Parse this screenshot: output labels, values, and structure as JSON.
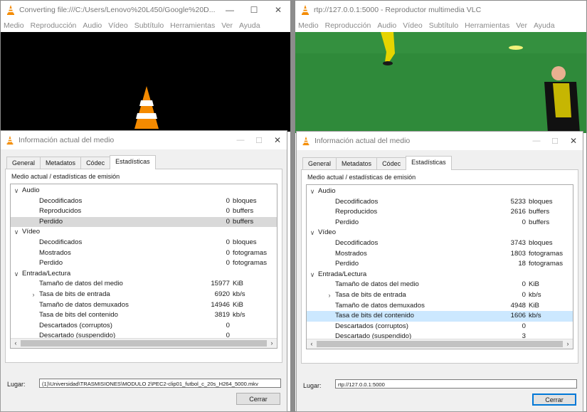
{
  "windows": [
    {
      "title": "Converting file:///C:/Users/Lenovo%20L450/Google%20D...",
      "menu": [
        "Medio",
        "Reproducción",
        "Audio",
        "Vídeo",
        "Subtítulo",
        "Herramientas",
        "Ver",
        "Ayuda"
      ],
      "controls": [
        "—",
        "☐",
        "✕"
      ]
    },
    {
      "title": "rtp://127.0.0.1:5000 - Reproductor multimedia VLC",
      "menu": [
        "Medio",
        "Reproducción",
        "Audio",
        "Vídeo",
        "Subtítulo",
        "Herramientas",
        "Ver",
        "Ayuda"
      ],
      "controls": [
        "—",
        "☐",
        "✕"
      ]
    }
  ],
  "dialogs": [
    {
      "title": "Información actual del medio",
      "tabs": [
        "General",
        "Metadatos",
        "Códec",
        "Estadísticas"
      ],
      "active_tab": "Estadísticas",
      "panel_title": "Medio actual / estadísticas de emisión",
      "rows": [
        {
          "type": "group",
          "label": "Audio",
          "exp": "∨"
        },
        {
          "type": "item",
          "label": "Decodificados",
          "value": "0",
          "unit": "bloques"
        },
        {
          "type": "item",
          "label": "Reproducidos",
          "value": "0",
          "unit": "buffers"
        },
        {
          "type": "item",
          "label": "Perdido",
          "value": "0",
          "unit": "buffers",
          "highlight": "gray"
        },
        {
          "type": "group",
          "label": "Vídeo",
          "exp": "∨"
        },
        {
          "type": "item",
          "label": "Decodificados",
          "value": "0",
          "unit": "bloques"
        },
        {
          "type": "item",
          "label": "Mostrados",
          "value": "0",
          "unit": "fotogramas"
        },
        {
          "type": "item",
          "label": "Perdido",
          "value": "0",
          "unit": "fotogramas"
        },
        {
          "type": "group",
          "label": "Entrada/Lectura",
          "exp": "∨"
        },
        {
          "type": "item",
          "label": "Tamaño de datos del medio",
          "value": "15977",
          "unit": "KiB"
        },
        {
          "type": "item",
          "label": "Tasa de bits de entrada",
          "value": "6920",
          "unit": "kb/s",
          "exp": "›"
        },
        {
          "type": "item",
          "label": "Tamaño de datos demuxados",
          "value": "14946",
          "unit": "KiB"
        },
        {
          "type": "item",
          "label": "Tasa de bits del contenido",
          "value": "3819",
          "unit": "kb/s"
        },
        {
          "type": "item",
          "label": "Descartados (corruptos)",
          "value": "0",
          "unit": ""
        },
        {
          "type": "item",
          "label": "Descartado (suspendido)",
          "value": "0",
          "unit": ""
        }
      ],
      "lugar_label": "Lugar:",
      "lugar_value": "(1)\\Universidad\\TRASMISIONES\\MODULO 2\\PEC2-clip01_futbol_c_20s_H264_5000.mkv",
      "close_label": "Cerrar"
    },
    {
      "title": "Información actual del medio",
      "tabs": [
        "General",
        "Metadatos",
        "Códec",
        "Estadísticas"
      ],
      "active_tab": "Estadísticas",
      "panel_title": "Medio actual / estadísticas de emisión",
      "rows": [
        {
          "type": "group",
          "label": "Audio",
          "exp": "∨"
        },
        {
          "type": "item",
          "label": "Decodificados",
          "value": "5233",
          "unit": "bloques"
        },
        {
          "type": "item",
          "label": "Reproducidos",
          "value": "2616",
          "unit": "buffers"
        },
        {
          "type": "item",
          "label": "Perdido",
          "value": "0",
          "unit": "buffers"
        },
        {
          "type": "group",
          "label": "Vídeo",
          "exp": "∨"
        },
        {
          "type": "item",
          "label": "Decodificados",
          "value": "3743",
          "unit": "bloques"
        },
        {
          "type": "item",
          "label": "Mostrados",
          "value": "1803",
          "unit": "fotogramas"
        },
        {
          "type": "item",
          "label": "Perdido",
          "value": "18",
          "unit": "fotogramas"
        },
        {
          "type": "group",
          "label": "Entrada/Lectura",
          "exp": "∨"
        },
        {
          "type": "item",
          "label": "Tamaño de datos del medio",
          "value": "0",
          "unit": "KiB"
        },
        {
          "type": "item",
          "label": "Tasa de bits de entrada",
          "value": "0",
          "unit": "kb/s",
          "exp": "›"
        },
        {
          "type": "item",
          "label": "Tamaño de datos demuxados",
          "value": "4948",
          "unit": "KiB"
        },
        {
          "type": "item",
          "label": "Tasa de bits del contenido",
          "value": "1606",
          "unit": "kb/s",
          "highlight": "blue"
        },
        {
          "type": "item",
          "label": "Descartados (corruptos)",
          "value": "0",
          "unit": ""
        },
        {
          "type": "item",
          "label": "Descartado (suspendido)",
          "value": "3",
          "unit": ""
        }
      ],
      "lugar_label": "Lugar:",
      "lugar_value": "rtp://127.0.0.1:5000",
      "close_label": "Cerrar"
    }
  ],
  "colors": {
    "vlc_orange": "#f48a00",
    "pitch_green": "#2f8a3a",
    "highlight_blue": "#cce8ff",
    "highlight_gray": "#d9d9d9"
  }
}
